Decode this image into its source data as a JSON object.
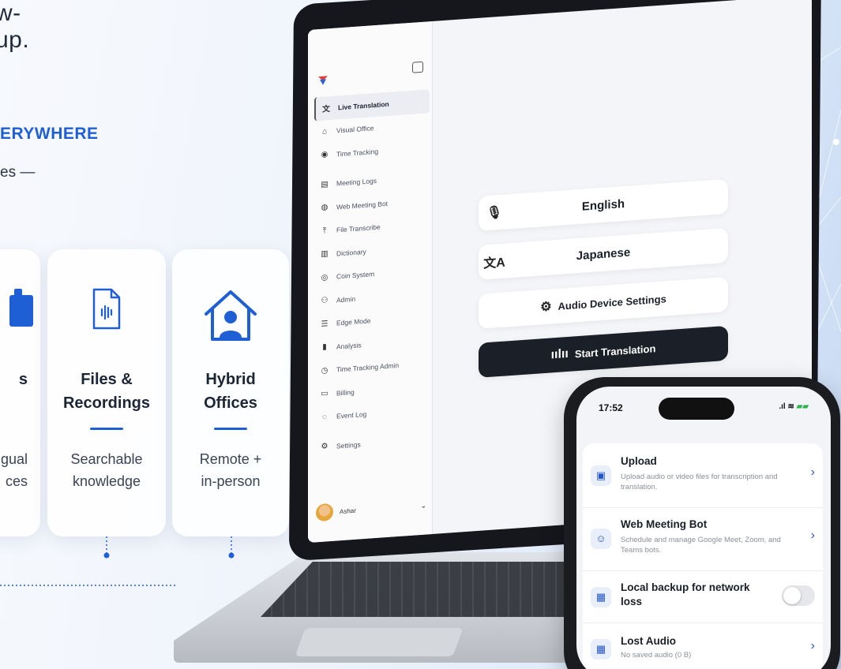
{
  "hero": {
    "headline_tail": "w-up.",
    "eyebrow": "ERYWHERE",
    "subtitle_tail": "es —"
  },
  "cards": [
    {
      "title": "s",
      "description": "gual\nces"
    },
    {
      "title": "Files &\nRecordings",
      "description": "Searchable\nknowledge"
    },
    {
      "title": "Hybrid\nOffices",
      "description": "Remote +\nin-person"
    }
  ],
  "laptop_app": {
    "sidebar": {
      "items": [
        {
          "label": "Live Translation",
          "icon": "translate-icon",
          "glyph": "文",
          "active": true
        },
        {
          "label": "Visual Office",
          "icon": "office-icon",
          "glyph": "⌂"
        },
        {
          "label": "Time Tracking",
          "icon": "clock-icon",
          "glyph": "◉"
        },
        {
          "label": "Meeting Logs",
          "icon": "meeting-logs-icon",
          "glyph": "▤"
        },
        {
          "label": "Web Meeting Bot",
          "icon": "bot-icon",
          "glyph": "◍"
        },
        {
          "label": "File Transcribe",
          "icon": "upload-icon",
          "glyph": "⤒"
        },
        {
          "label": "Dictionary",
          "icon": "dictionary-icon",
          "glyph": "▥"
        },
        {
          "label": "Coin System",
          "icon": "coin-icon",
          "glyph": "◎"
        },
        {
          "label": "Admin",
          "icon": "admin-icon",
          "glyph": "⚇"
        },
        {
          "label": "Edge Mode",
          "icon": "edge-mode-icon",
          "glyph": "☰"
        },
        {
          "label": "Analysis",
          "icon": "analysis-icon",
          "glyph": "▮"
        },
        {
          "label": "Time Tracking Admin",
          "icon": "clock-admin-icon",
          "glyph": "◷"
        },
        {
          "label": "Billing",
          "icon": "billing-icon",
          "glyph": "▭"
        },
        {
          "label": "Event Log",
          "icon": "event-log-icon",
          "glyph": "◌"
        },
        {
          "label": "Settings",
          "icon": "settings-icon",
          "glyph": "⚙"
        }
      ],
      "user": {
        "name": "Ashar"
      }
    },
    "main": {
      "source_language": "English",
      "target_language": "Japanese",
      "audio_settings_label": "Audio Device Settings",
      "start_label": "Start Translation"
    }
  },
  "phone_app": {
    "status": {
      "time": "17:52",
      "signal": ".ıl",
      "wifi": "≋",
      "battery": "▰▰"
    },
    "rows": [
      {
        "title": "Upload",
        "subtitle": "Upload audio or video files for transcription and translation.",
        "icon": "upload-file-icon",
        "glyph": "▣",
        "control": "chevron"
      },
      {
        "title": "Web Meeting Bot",
        "subtitle": "Schedule and manage Google Meet, Zoom, and Teams bots.",
        "icon": "bot-icon",
        "glyph": "☺",
        "control": "chevron"
      },
      {
        "title": "Local backup for network loss",
        "subtitle": "",
        "icon": "backup-icon",
        "glyph": "▦",
        "control": "toggle",
        "toggle_on": false
      },
      {
        "title": "Lost Audio",
        "subtitle": "No saved audio (0 B)",
        "icon": "lost-audio-icon",
        "glyph": "▦",
        "control": "chevron"
      }
    ]
  },
  "colors": {
    "accent": "#1f5fd6",
    "dark_button": "#1b1f27",
    "phone_accent": "#2457c5"
  }
}
